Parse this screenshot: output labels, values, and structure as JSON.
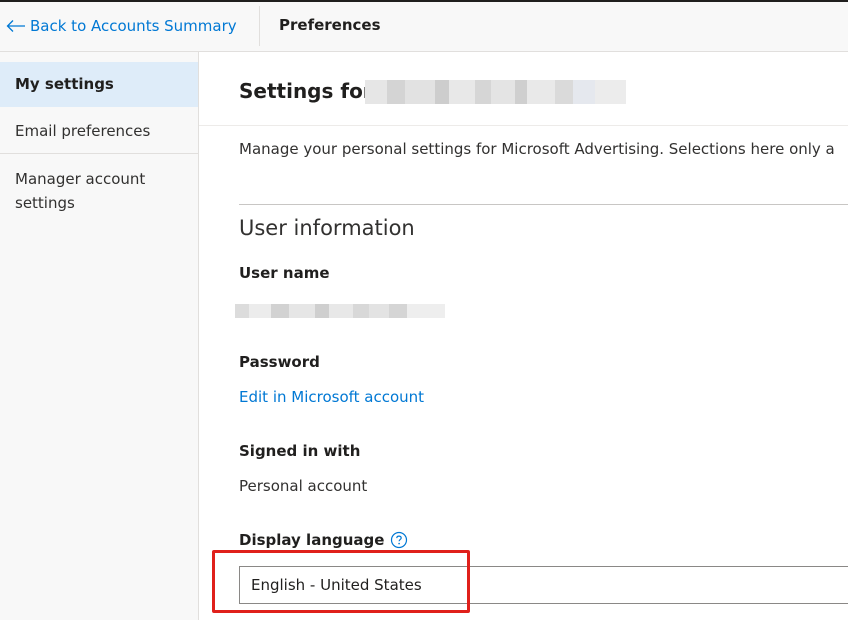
{
  "header": {
    "back_link": "Back to Accounts Summary",
    "title": "Preferences"
  },
  "sidebar": {
    "items": [
      {
        "label": "My settings",
        "active": true
      },
      {
        "label": "Email preferences",
        "active": false
      },
      {
        "label": "Manager account settings",
        "active": false
      }
    ]
  },
  "main": {
    "settings_title": "Settings for",
    "description": "Manage your personal settings for Microsoft Advertising. Selections here only a",
    "section_title": "User information",
    "user_name": {
      "label": "User name"
    },
    "password": {
      "label": "Password",
      "link": "Edit in Microsoft account"
    },
    "signed_in": {
      "label": "Signed in with",
      "value": "Personal account"
    },
    "display_language": {
      "label": "Display language",
      "help_icon": "question-circle-icon",
      "selected": "English - United States"
    }
  },
  "colors": {
    "accent": "#0078d4",
    "active_nav": "#deecf9",
    "highlight_border": "#e0201b"
  }
}
